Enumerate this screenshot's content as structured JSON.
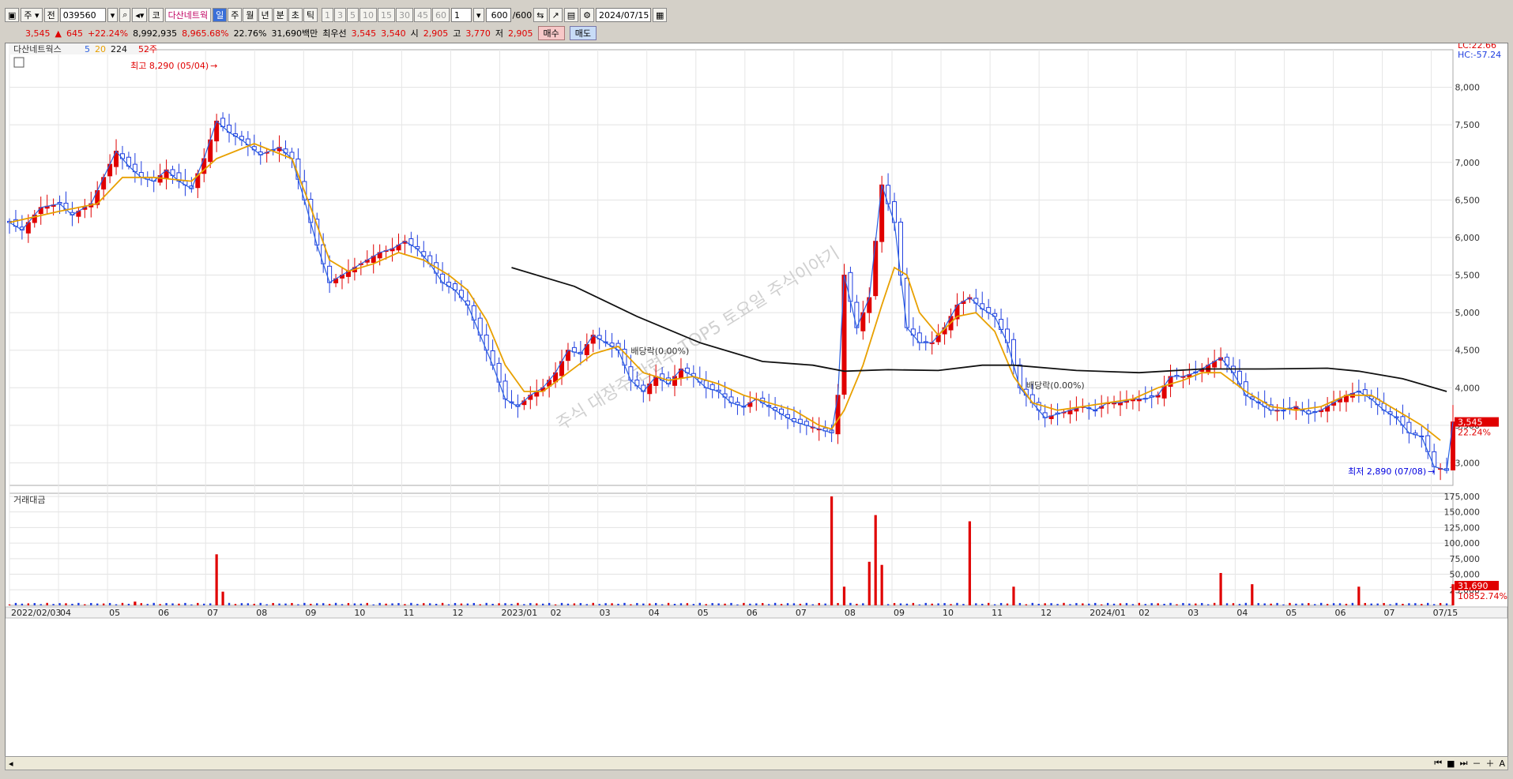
{
  "toolbar": {
    "mode": "주",
    "prefix": "전",
    "code": "039560",
    "market": "코",
    "name": "다산네트웍",
    "periods": [
      "일",
      "주",
      "월",
      "년",
      "분",
      "초",
      "틱"
    ],
    "active_period": "일",
    "nums": [
      "1",
      "3",
      "5",
      "10",
      "15",
      "30",
      "45",
      "60"
    ],
    "count_sel": "1",
    "count": "600",
    "count_total": "/600",
    "date": "2024/07/15"
  },
  "info": {
    "price": "3,545",
    "arrow": "▲",
    "change": "645",
    "pct": "+22.24%",
    "volume": "8,992,935",
    "vol_pct": "8,965.68%",
    "turnover": "22.76%",
    "amount": "31,690백만",
    "best_label": "최우선",
    "best_ask": "3,545",
    "best_bid": "3,540",
    "open_label": "시",
    "open": "2,905",
    "high_label": "고",
    "high": "3,770",
    "low_label": "저",
    "low": "2,905",
    "buy": "매수",
    "sell": "매도"
  },
  "chart_data": [
    {
      "type": "candlestick",
      "legend": {
        "name": "다산네트웍스",
        "ma5": "5",
        "ma20": "20",
        "ma224": "224",
        "w52": "52주"
      },
      "colors": {
        "up": "#e00000",
        "down": "#1f3ee0",
        "ma5": "#2a5fe0",
        "ma20": "#e8a000",
        "ma224": "#111111"
      },
      "ylim": [
        2700,
        8500
      ],
      "y_ticks": [
        "3,000",
        "3,500",
        "4,000",
        "4,500",
        "5,000",
        "5,500",
        "6,000",
        "6,500",
        "7,000",
        "7,500",
        "8,000"
      ],
      "x_ticks": [
        "2022/02/03",
        "04",
        "05",
        "06",
        "07",
        "08",
        "09",
        "10",
        "11",
        "12",
        "2023/01",
        "02",
        "03",
        "04",
        "05",
        "06",
        "07",
        "08",
        "09",
        "10",
        "11",
        "12",
        "2024/01",
        "02",
        "03",
        "04",
        "05",
        "06",
        "07",
        "07/15"
      ],
      "price_path": [
        [
          0,
          6200
        ],
        [
          2,
          6100
        ],
        [
          5,
          6400
        ],
        [
          8,
          6450
        ],
        [
          10,
          6300
        ],
        [
          13,
          6450
        ],
        [
          15,
          6800
        ],
        [
          17,
          7150
        ],
        [
          19,
          6950
        ],
        [
          21,
          6800
        ],
        [
          23,
          6750
        ],
        [
          25,
          6900
        ],
        [
          27,
          6750
        ],
        [
          29,
          6650
        ],
        [
          31,
          7050
        ],
        [
          33,
          7550
        ],
        [
          35,
          7400
        ],
        [
          37,
          7300
        ],
        [
          40,
          7100
        ],
        [
          43,
          7200
        ],
        [
          45,
          7050
        ],
        [
          47,
          6500
        ],
        [
          49,
          5900
        ],
        [
          51,
          5400
        ],
        [
          53,
          5500
        ],
        [
          55,
          5600
        ],
        [
          57,
          5700
        ],
        [
          59,
          5800
        ],
        [
          61,
          5850
        ],
        [
          63,
          5950
        ],
        [
          65,
          5850
        ],
        [
          67,
          5650
        ],
        [
          69,
          5400
        ],
        [
          71,
          5300
        ],
        [
          73,
          5100
        ],
        [
          75,
          4700
        ],
        [
          77,
          4300
        ],
        [
          79,
          3850
        ],
        [
          81,
          3750
        ],
        [
          83,
          3900
        ],
        [
          85,
          4000
        ],
        [
          87,
          4200
        ],
        [
          89,
          4500
        ],
        [
          91,
          4450
        ],
        [
          93,
          4700
        ],
        [
          95,
          4600
        ],
        [
          97,
          4500
        ],
        [
          99,
          4100
        ],
        [
          101,
          3950
        ],
        [
          103,
          4150
        ],
        [
          105,
          4050
        ],
        [
          107,
          4250
        ],
        [
          109,
          4150
        ],
        [
          111,
          4000
        ],
        [
          113,
          3950
        ],
        [
          115,
          3800
        ],
        [
          117,
          3750
        ],
        [
          119,
          3850
        ],
        [
          121,
          3750
        ],
        [
          123,
          3650
        ],
        [
          125,
          3550
        ],
        [
          127,
          3500
        ],
        [
          129,
          3450
        ],
        [
          131,
          3400
        ],
        [
          132,
          3900
        ],
        [
          133,
          5500
        ],
        [
          135,
          4800
        ],
        [
          137,
          5200
        ],
        [
          139,
          6700
        ],
        [
          141,
          6200
        ],
        [
          143,
          4800
        ],
        [
          145,
          4600
        ],
        [
          147,
          4600
        ],
        [
          149,
          4800
        ],
        [
          151,
          5100
        ],
        [
          153,
          5200
        ],
        [
          155,
          5050
        ],
        [
          157,
          4950
        ],
        [
          159,
          4600
        ],
        [
          161,
          4000
        ],
        [
          163,
          3800
        ],
        [
          165,
          3600
        ],
        [
          167,
          3650
        ],
        [
          169,
          3700
        ],
        [
          171,
          3750
        ],
        [
          173,
          3700
        ],
        [
          175,
          3800
        ],
        [
          177,
          3800
        ],
        [
          179,
          3850
        ],
        [
          181,
          3850
        ],
        [
          183,
          3900
        ],
        [
          185,
          4150
        ],
        [
          187,
          4150
        ],
        [
          189,
          4200
        ],
        [
          191,
          4300
        ],
        [
          193,
          4400
        ],
        [
          195,
          4200
        ],
        [
          197,
          3900
        ],
        [
          199,
          3800
        ],
        [
          201,
          3700
        ],
        [
          203,
          3700
        ],
        [
          205,
          3750
        ],
        [
          207,
          3650
        ],
        [
          209,
          3700
        ],
        [
          211,
          3800
        ],
        [
          213,
          3900
        ],
        [
          215,
          3950
        ],
        [
          217,
          3850
        ],
        [
          219,
          3700
        ],
        [
          221,
          3600
        ],
        [
          223,
          3400
        ],
        [
          225,
          3350
        ],
        [
          227,
          2950
        ],
        [
          229,
          2900
        ],
        [
          230,
          3545
        ]
      ],
      "ma20_path": [
        [
          0,
          6200
        ],
        [
          8,
          6350
        ],
        [
          14,
          6450
        ],
        [
          18,
          6800
        ],
        [
          23,
          6800
        ],
        [
          29,
          6750
        ],
        [
          33,
          7050
        ],
        [
          39,
          7250
        ],
        [
          45,
          7050
        ],
        [
          48,
          6400
        ],
        [
          51,
          5700
        ],
        [
          54,
          5550
        ],
        [
          58,
          5650
        ],
        [
          62,
          5800
        ],
        [
          66,
          5700
        ],
        [
          70,
          5500
        ],
        [
          73,
          5300
        ],
        [
          76,
          4900
        ],
        [
          79,
          4300
        ],
        [
          82,
          3950
        ],
        [
          85,
          3950
        ],
        [
          89,
          4200
        ],
        [
          93,
          4450
        ],
        [
          97,
          4550
        ],
        [
          101,
          4200
        ],
        [
          105,
          4100
        ],
        [
          109,
          4150
        ],
        [
          113,
          4050
        ],
        [
          117,
          3900
        ],
        [
          121,
          3800
        ],
        [
          125,
          3700
        ],
        [
          129,
          3500
        ],
        [
          131,
          3450
        ],
        [
          133,
          3700
        ],
        [
          136,
          4300
        ],
        [
          139,
          5100
        ],
        [
          141,
          5600
        ],
        [
          143,
          5500
        ],
        [
          145,
          5000
        ],
        [
          148,
          4700
        ],
        [
          151,
          4950
        ],
        [
          154,
          5000
        ],
        [
          157,
          4750
        ],
        [
          160,
          4150
        ],
        [
          163,
          3800
        ],
        [
          167,
          3700
        ],
        [
          171,
          3750
        ],
        [
          175,
          3800
        ],
        [
          179,
          3850
        ],
        [
          183,
          4000
        ],
        [
          187,
          4100
        ],
        [
          190,
          4200
        ],
        [
          193,
          4200
        ],
        [
          197,
          3950
        ],
        [
          201,
          3750
        ],
        [
          205,
          3700
        ],
        [
          209,
          3750
        ],
        [
          213,
          3900
        ],
        [
          217,
          3900
        ],
        [
          221,
          3700
        ],
        [
          225,
          3500
        ],
        [
          228,
          3300
        ]
      ],
      "ma224_path": [
        [
          80,
          5600
        ],
        [
          90,
          5350
        ],
        [
          100,
          4950
        ],
        [
          110,
          4600
        ],
        [
          120,
          4350
        ],
        [
          128,
          4300
        ],
        [
          133,
          4220
        ],
        [
          140,
          4240
        ],
        [
          148,
          4230
        ],
        [
          155,
          4300
        ],
        [
          160,
          4300
        ],
        [
          170,
          4230
        ],
        [
          180,
          4200
        ],
        [
          190,
          4250
        ],
        [
          200,
          4250
        ],
        [
          210,
          4260
        ],
        [
          215,
          4220
        ],
        [
          222,
          4120
        ],
        [
          229,
          3950
        ]
      ],
      "annotations": [
        {
          "text": "최고 8,290 (05/04)",
          "x": 33,
          "y": 8290
        },
        {
          "text": "최저 2,890 (07/08)",
          "x": 227,
          "y": 2890
        },
        {
          "text": "배당락(0.00%)",
          "x": 99,
          "y": 4450
        },
        {
          "text": "배당락(0.00%)",
          "x": 162,
          "y": 3990
        }
      ],
      "side_labels": {
        "lc": "LC:22.66",
        "hc": "HC:-57.24",
        "last_price": "3,545",
        "last_pct": "22.24%"
      },
      "watermark": "주식 대장주 관련주 TOP5 토요일 주식이야기"
    },
    {
      "type": "bar",
      "title": "거래대금",
      "ylim": [
        0,
        180000
      ],
      "y_ticks": [
        "25,000",
        "50,000",
        "75,000",
        "100,000",
        "125,000",
        "150,000",
        "175,000"
      ],
      "spikes": [
        [
          20,
          6000
        ],
        [
          33,
          82000
        ],
        [
          34,
          22000
        ],
        [
          131,
          175000
        ],
        [
          133,
          30000
        ],
        [
          137,
          70000
        ],
        [
          138,
          145000
        ],
        [
          139,
          65000
        ],
        [
          153,
          135000
        ],
        [
          160,
          30000
        ],
        [
          193,
          52000
        ],
        [
          198,
          34000
        ],
        [
          215,
          30000
        ],
        [
          230,
          34000
        ]
      ],
      "last_value": "31,690",
      "last_pct": "10852.74%"
    }
  ]
}
